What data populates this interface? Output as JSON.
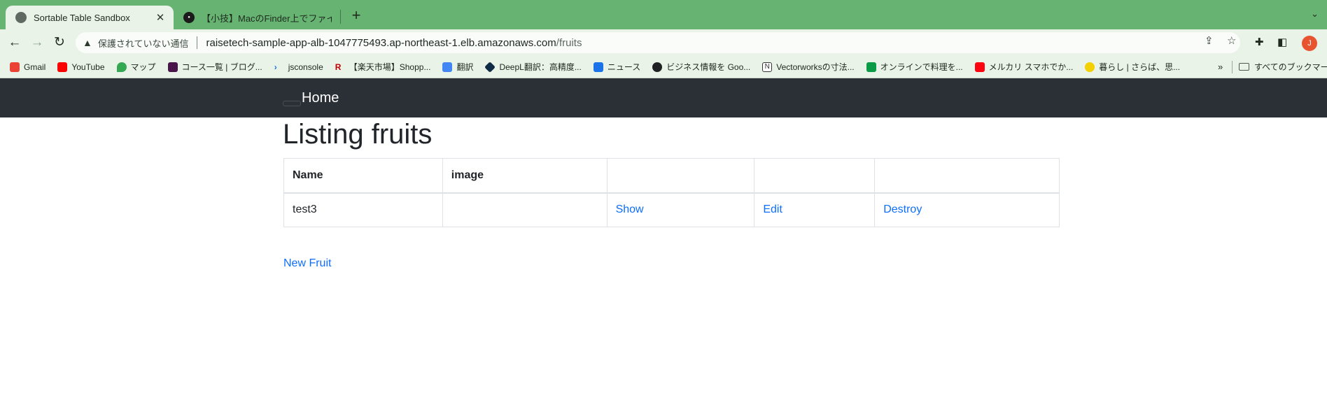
{
  "browser": {
    "tabs": [
      {
        "title": "Sortable Table Sandbox",
        "active": true
      },
      {
        "title": "【小技】MacのFinder上でファイ",
        "active": false
      }
    ],
    "address": {
      "security_label": "保護されていない通信",
      "host": "raisetech-sample-app-alb-1047775493.ap-northeast-1.elb.amazonaws.com",
      "path": "/fruits"
    },
    "profile_initial": "J",
    "bookmarks": [
      {
        "label": "Gmail",
        "color": "#ea4335"
      },
      {
        "label": "YouTube",
        "color": "#ff0000"
      },
      {
        "label": "マップ",
        "color": "#34a853"
      },
      {
        "label": "コース一覧 | ブログ...",
        "color": "#4a154b"
      },
      {
        "label": "jsconsole",
        "color": "#1a73e8"
      },
      {
        "label": "【楽天市場】Shopp...",
        "color": "#bf0000"
      },
      {
        "label": "翻訳",
        "color": "#4285f4"
      },
      {
        "label": "DeepL翻訳：高精度...",
        "color": "#0f2b46"
      },
      {
        "label": "ニュース",
        "color": "#1a73e8"
      },
      {
        "label": "ビジネス情報を Goo...",
        "color": "#202124"
      },
      {
        "label": "Vectorworksの寸法...",
        "color": "#333333"
      },
      {
        "label": "オンラインで料理を...",
        "color": "#0b9b47"
      },
      {
        "label": "メルカリ スマホでか...",
        "color": "#ff0211"
      },
      {
        "label": "暮らし | さらば、思...",
        "color": "#e8c000"
      }
    ],
    "all_bookmarks_label": "すべてのブックマー"
  },
  "app": {
    "nav_home": "Home",
    "title": "Listing fruits",
    "table": {
      "headers": [
        "Name",
        "image",
        "",
        "",
        ""
      ],
      "rows": [
        {
          "name": "test3",
          "image": "",
          "show": "Show",
          "edit": "Edit",
          "destroy": "Destroy"
        }
      ]
    },
    "new_link": "New Fruit",
    "link_color": "#0d6efd",
    "nav_color": "#2b3036"
  }
}
